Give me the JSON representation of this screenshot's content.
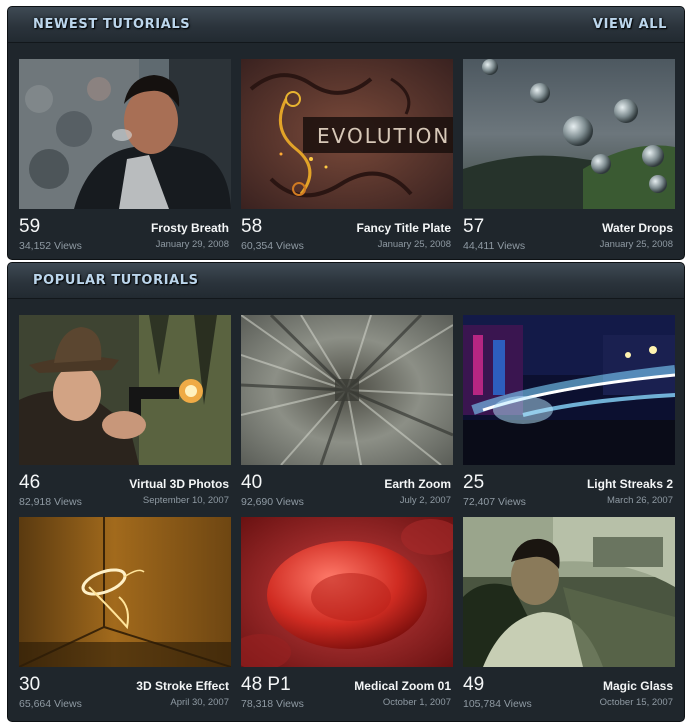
{
  "newest": {
    "title": "NEWEST TUTORIALS",
    "view_all": "VIEW ALL",
    "items": [
      {
        "number": "59",
        "views": "34,152 Views",
        "title": "Frosty Breath",
        "date": "January 29, 2008"
      },
      {
        "number": "58",
        "views": "60,354 Views",
        "title": "Fancy Title Plate",
        "date": "January 25, 2008",
        "thumb_text": "EVOLUTION"
      },
      {
        "number": "57",
        "views": "44,411 Views",
        "title": "Water Drops",
        "date": "January 25, 2008"
      }
    ]
  },
  "popular": {
    "title": "POPULAR TUTORIALS",
    "items": [
      {
        "number": "46",
        "views": "82,918 Views",
        "title": "Virtual 3D Photos",
        "date": "September 10, 2007"
      },
      {
        "number": "40",
        "views": "92,690 Views",
        "title": "Earth Zoom",
        "date": "July 2, 2007"
      },
      {
        "number": "25",
        "views": "72,407 Views",
        "title": "Light Streaks 2",
        "date": "March 26, 2007"
      },
      {
        "number": "30",
        "views": "65,664 Views",
        "title": "3D Stroke Effect",
        "date": "April 30, 2007"
      },
      {
        "number": "48 P1",
        "views": "78,318 Views",
        "title": "Medical Zoom 01",
        "date": "October 1, 2007"
      },
      {
        "number": "49",
        "views": "105,784 Views",
        "title": "Magic Glass",
        "date": "October 15, 2007"
      }
    ]
  },
  "colors": {
    "panel_bg": "#1f262c",
    "header_text": "#bcd6ec",
    "number_text": "#f4f6f7",
    "meta_text": "#8f9aa3"
  }
}
